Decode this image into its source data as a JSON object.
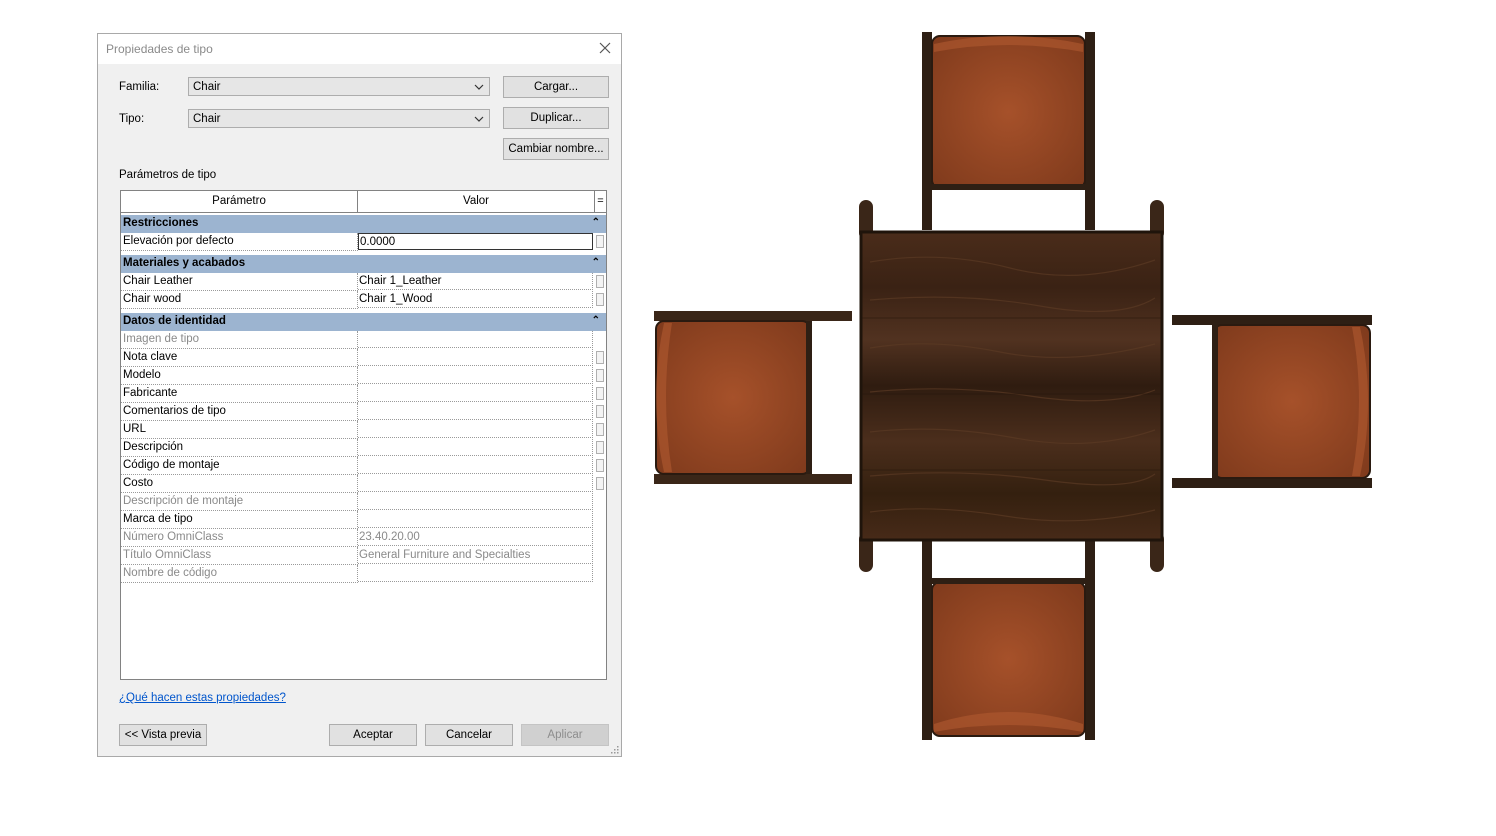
{
  "dialog": {
    "title": "Propiedades de tipo",
    "familia_label": "Familia:",
    "familia_value": "Chair",
    "tipo_label": "Tipo:",
    "tipo_value": "Chair",
    "cargar_button": "Cargar...",
    "duplicar_button": "Duplicar...",
    "cambiar_button": "Cambiar nombre...",
    "params_label": "Parámetros de tipo",
    "col_param": "Parámetro",
    "col_valor": "Valor",
    "col_eq": "=",
    "help_link": "¿Qué hacen estas propiedades?",
    "preview_button": "<< Vista previa",
    "ok_button": "Aceptar",
    "cancel_button": "Cancelar",
    "apply_button": "Aplicar"
  },
  "groups": {
    "restricciones": "Restricciones",
    "materiales": "Materiales y acabados",
    "identidad": "Datos de identidad"
  },
  "rows": {
    "elevacion": {
      "param": "Elevación por defecto",
      "value": "0.0000"
    },
    "leather": {
      "param": "Chair Leather",
      "value": "Chair 1_Leather"
    },
    "wood": {
      "param": "Chair wood",
      "value": "Chair 1_Wood"
    },
    "imagen": {
      "param": "Imagen de tipo",
      "value": ""
    },
    "nota": {
      "param": "Nota clave",
      "value": ""
    },
    "modelo": {
      "param": "Modelo",
      "value": ""
    },
    "fabricante": {
      "param": "Fabricante",
      "value": ""
    },
    "comentarios": {
      "param": "Comentarios de tipo",
      "value": ""
    },
    "url": {
      "param": "URL",
      "value": ""
    },
    "descripcion": {
      "param": "Descripción",
      "value": ""
    },
    "codigo": {
      "param": "Código de montaje",
      "value": ""
    },
    "costo": {
      "param": "Costo",
      "value": ""
    },
    "descmontaje": {
      "param": "Descripción de montaje",
      "value": ""
    },
    "marca": {
      "param": "Marca de tipo",
      "value": ""
    },
    "numomni": {
      "param": "Número OmniClass",
      "value": "23.40.20.00"
    },
    "titomni": {
      "param": "Título OmniClass",
      "value": "General Furniture and Specialties"
    },
    "nombrecod": {
      "param": "Nombre de código",
      "value": ""
    }
  },
  "colors": {
    "group_header": "#9cb4d0",
    "wood": "#3f2616",
    "leather": "#9a4a26",
    "frame": "#3a2618"
  }
}
